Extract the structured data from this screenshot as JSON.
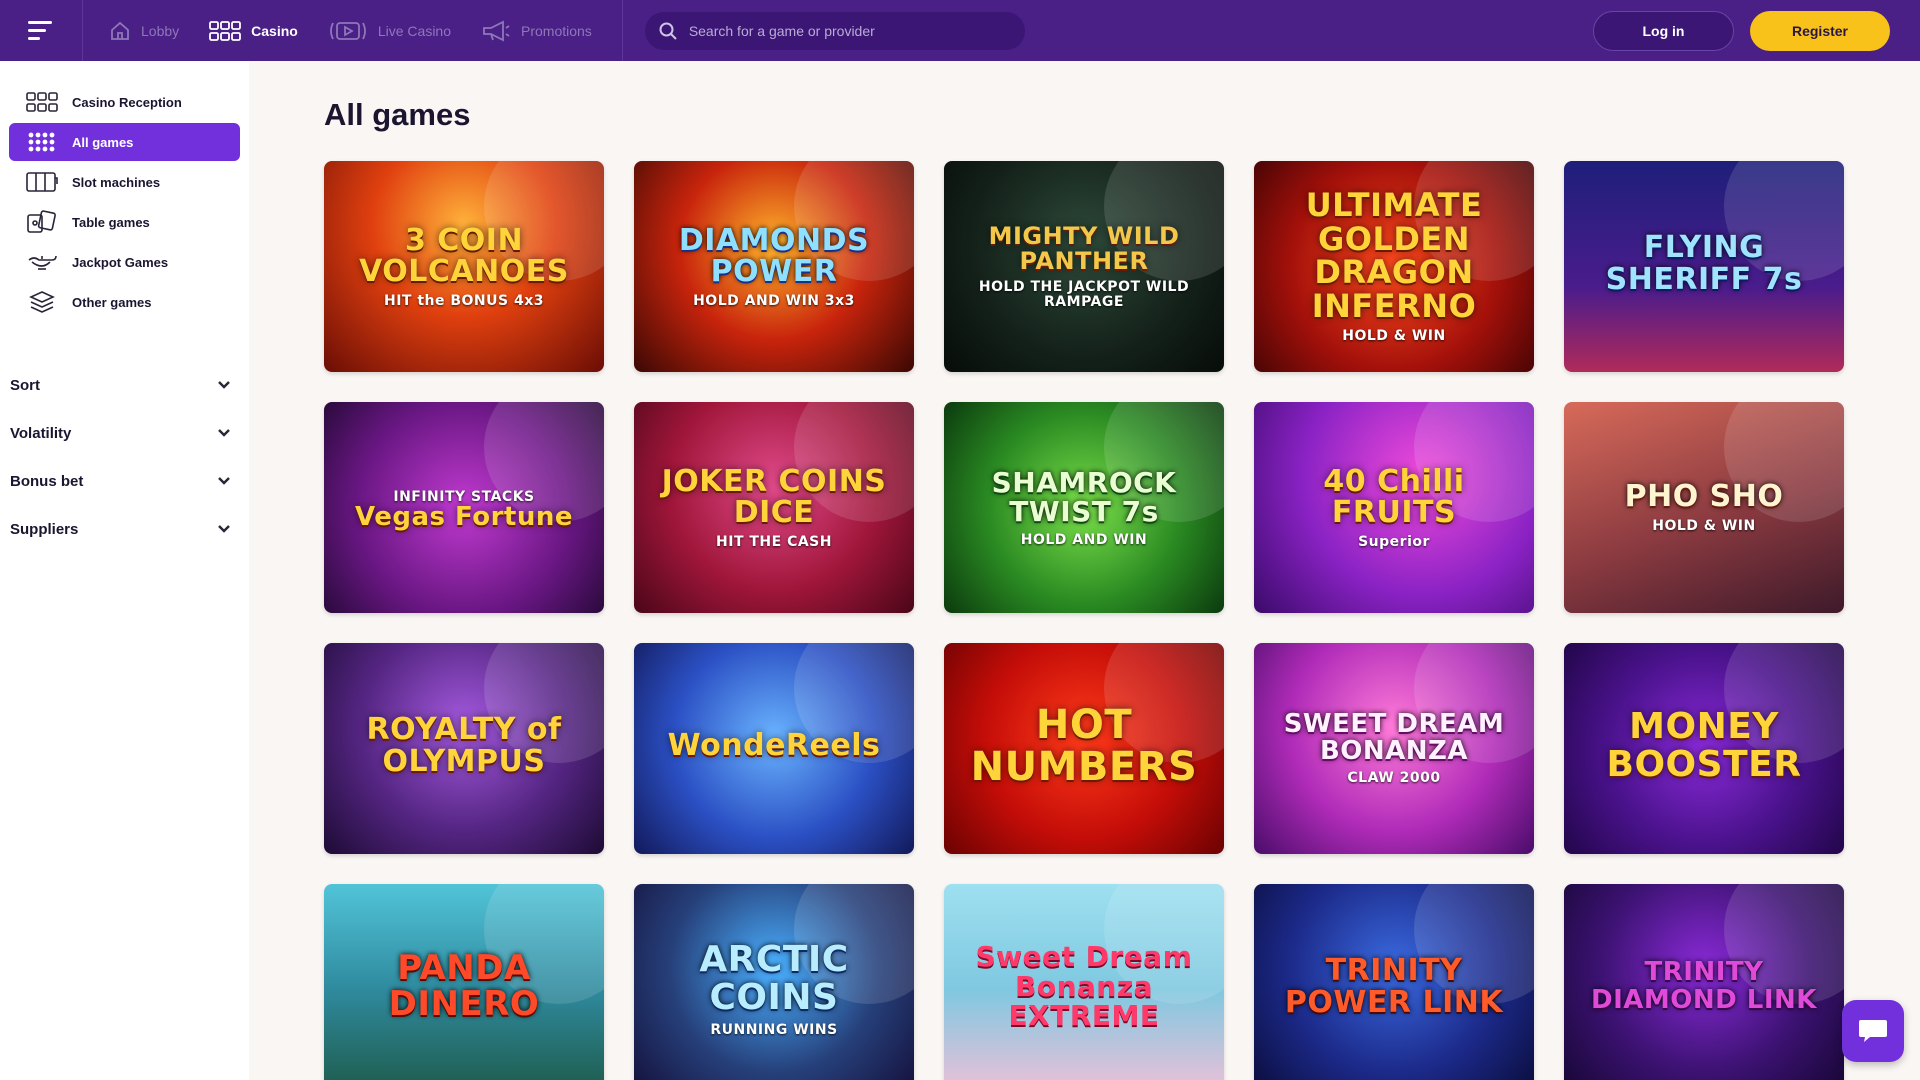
{
  "header": {
    "nav": [
      {
        "label": "Lobby",
        "icon": "home-icon"
      },
      {
        "label": "Casino",
        "icon": "grid-icon",
        "active": true
      },
      {
        "label": "Live Casino",
        "icon": "live-play-icon"
      },
      {
        "label": "Promotions",
        "icon": "megaphone-icon"
      }
    ],
    "search_placeholder": "Search for a game or provider",
    "login_label": "Log in",
    "register_label": "Register"
  },
  "sidebar": {
    "items": [
      {
        "label": "Casino Reception",
        "icon": "grid-icon"
      },
      {
        "label": "All games",
        "icon": "dots-grid-icon",
        "active": true
      },
      {
        "label": "Slot machines",
        "icon": "slot-reels-icon"
      },
      {
        "label": "Table games",
        "icon": "cards-icon"
      },
      {
        "label": "Jackpot Games",
        "icon": "lamp-icon"
      },
      {
        "label": "Other games",
        "icon": "layers-icon"
      }
    ],
    "filters": [
      {
        "label": "Sort"
      },
      {
        "label": "Volatility"
      },
      {
        "label": "Bonus bet"
      },
      {
        "label": "Suppliers"
      }
    ]
  },
  "main": {
    "title": "All games",
    "games": [
      {
        "title": "3 COIN VOLCANOES",
        "sub": "HIT the BONUS 4x3"
      },
      {
        "title": "DIAMONDS POWER",
        "sub": "HOLD AND WIN 3x3"
      },
      {
        "title": "MIGHTY WILD PANTHER",
        "sub": "HOLD THE JACKPOT WILD RAMPAGE"
      },
      {
        "title": "ULTIMATE GOLDEN DRAGON INFERNO",
        "sub": "HOLD & WIN"
      },
      {
        "title": "FLYING SHERIFF 7s",
        "sub": ""
      },
      {
        "title": "Vegas Fortune",
        "sub": "INFINITY STACKS"
      },
      {
        "title": "JOKER COINS DICE",
        "sub": "HIT THE CASH"
      },
      {
        "title": "SHAMROCK TWIST 7s",
        "sub": "HOLD AND WIN"
      },
      {
        "title": "40 Chilli FRUITS",
        "sub": "Superior"
      },
      {
        "title": "PHO SHO",
        "sub": "HOLD & WIN"
      },
      {
        "title": "ROYALTY of OLYMPUS",
        "sub": ""
      },
      {
        "title": "WondeReels",
        "sub": ""
      },
      {
        "title": "HOT NUMBERS",
        "sub": ""
      },
      {
        "title": "SWEET DREAM BONANZA",
        "sub": "CLAW 2000"
      },
      {
        "title": "MONEY BOOSTER",
        "sub": ""
      },
      {
        "title": "PANDA DINERO",
        "sub": ""
      },
      {
        "title": "ARCTIC COINS",
        "sub": "RUNNING WINS"
      },
      {
        "title": "Sweet Dream Bonanza EXTREME",
        "sub": ""
      },
      {
        "title": "TRINITY POWER LINK",
        "sub": ""
      },
      {
        "title": "TRINITY DIAMOND LINK",
        "sub": ""
      }
    ]
  },
  "colors": {
    "header_bg": "#4a1f86",
    "accent": "#7230dc",
    "register": "#f8c21a"
  }
}
